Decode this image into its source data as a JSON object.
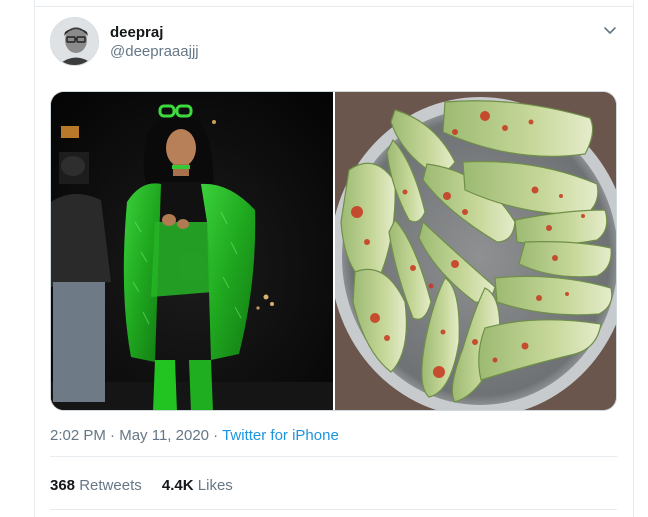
{
  "tweet": {
    "author": {
      "display_name": "deepraj",
      "handle": "@deepraaajjj"
    },
    "timestamp": {
      "time": "2:02 PM",
      "date": "May 11, 2020",
      "separator": "·"
    },
    "source": "Twitter for iPhone",
    "stats": {
      "retweets": {
        "count": "368",
        "label": "Retweets"
      },
      "likes": {
        "count": "4.4K",
        "label": "Likes"
      }
    },
    "media": [
      {
        "kind": "photo",
        "subject": "person-in-green-fur-coat"
      },
      {
        "kind": "photo",
        "subject": "raw-mango-slices-with-chili-on-plate"
      }
    ]
  },
  "icons": {
    "caret": "chevron-down-icon"
  },
  "colors": {
    "link": "#1b95e0",
    "muted": "#657786",
    "text": "#14171a",
    "divider": "#e6ecf0"
  }
}
